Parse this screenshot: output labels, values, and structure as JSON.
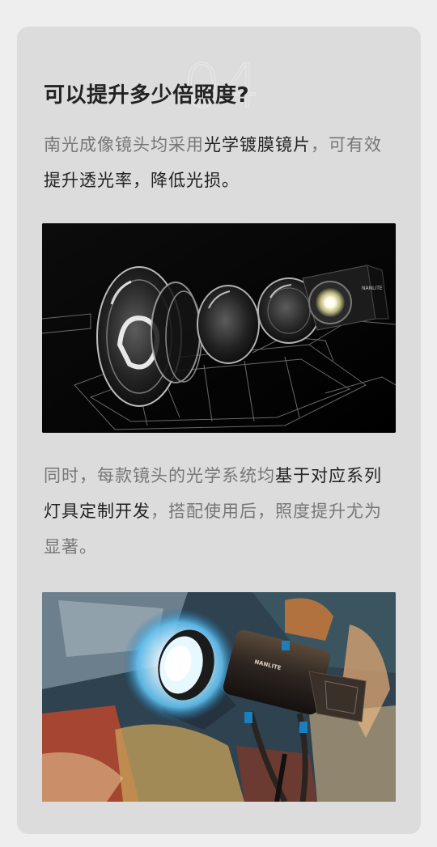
{
  "section": {
    "number": "04",
    "title": "可以提升多少倍照度?"
  },
  "paragraph1": {
    "part1": "南光成像镜头均采用",
    "highlight": "光学镀膜镜片",
    "part2": "，可有效",
    "line2": "提升透光率，降低光损。"
  },
  "paragraph2": {
    "part1": "同时，每款镜头的光学系统均",
    "highlight1": "基于对应系列",
    "highlight2": "灯具定制开发",
    "part2": "，搭配使用后，照度提升尤为",
    "line3": "显著。"
  },
  "images": {
    "lens": {
      "brand_text": "NANLITE"
    },
    "light": {
      "brand_text": "NANLITE"
    }
  },
  "colors": {
    "page_bg": "#eeeeee",
    "card_bg": "#dcdcdc",
    "title": "#222222",
    "body_text": "#777777",
    "highlight_text": "#222222"
  }
}
